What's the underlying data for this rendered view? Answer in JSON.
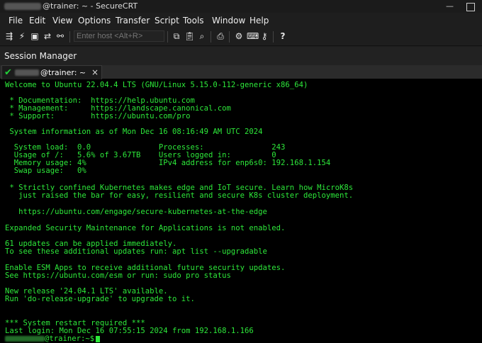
{
  "window": {
    "title": "@trainer: ~ - SecureCRT",
    "minimize_glyph": "—"
  },
  "menu": [
    "File",
    "Edit",
    "View",
    "Options",
    "Transfer",
    "Script",
    "Tools",
    "Window",
    "Help"
  ],
  "toolbar": {
    "host_placeholder": "Enter host <Alt+R>",
    "icons": [
      "connect-icon",
      "quick-connect-icon",
      "tab-icon",
      "reconnect-icon",
      "disconnect-icon",
      "copy-icon",
      "paste-icon",
      "find-icon",
      "print-icon",
      "settings-icon",
      "keymap-icon",
      "key-icon",
      "help-icon"
    ]
  },
  "session_manager": {
    "label": "Session Manager"
  },
  "tab": {
    "label": "@trainer: ~",
    "close": "×",
    "status_color": "#22d13a"
  },
  "terminal": {
    "lines": [
      "Welcome to Ubuntu 22.04.4 LTS (GNU/Linux 5.15.0-112-generic x86_64)",
      "",
      " * Documentation:  https://help.ubuntu.com",
      " * Management:     https://landscape.canonical.com",
      " * Support:        https://ubuntu.com/pro",
      "",
      " System information as of Mon Dec 16 08:16:49 AM UTC 2024",
      "",
      "  System load:  0.0               Processes:               243",
      "  Usage of /:   5.6% of 3.67TB    Users logged in:         0",
      "  Memory usage: 4%                IPv4 address for enp6s0: 192.168.1.154",
      "  Swap usage:   0%",
      "",
      " * Strictly confined Kubernetes makes edge and IoT secure. Learn how MicroK8s",
      "   just raised the bar for easy, resilient and secure K8s cluster deployment.",
      "",
      "   https://ubuntu.com/engage/secure-kubernetes-at-the-edge",
      "",
      "Expanded Security Maintenance for Applications is not enabled.",
      "",
      "61 updates can be applied immediately.",
      "To see these additional updates run: apt list --upgradable",
      "",
      "Enable ESM Apps to receive additional future security updates.",
      "See https://ubuntu.com/esm or run: sudo pro status",
      "",
      "New release '24.04.1 LTS' available.",
      "Run 'do-release-upgrade' to upgrade to it.",
      "",
      "",
      "*** System restart required ***",
      "Last login: Mon Dec 16 07:55:15 2024 from 192.168.1.166"
    ],
    "prompt": "@trainer:~$",
    "text_color": "#2de83a"
  }
}
